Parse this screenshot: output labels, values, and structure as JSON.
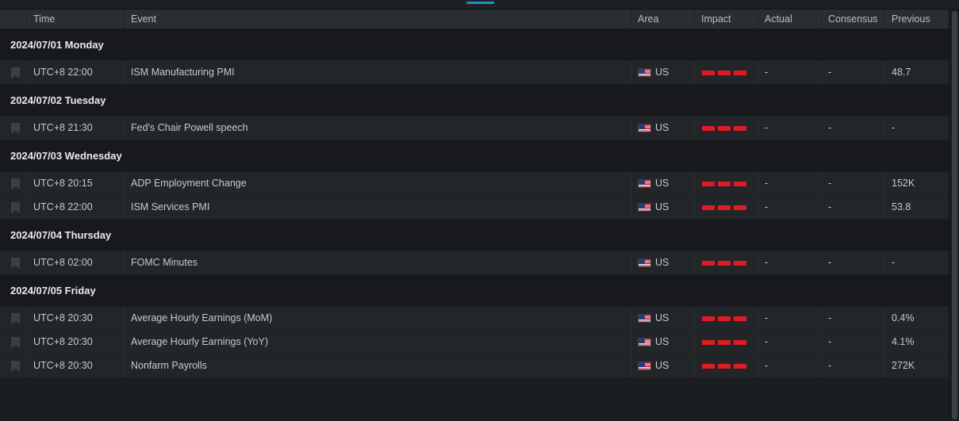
{
  "window": {
    "tab_indicator_color": "#1c94c4",
    "accent_color": "#1c94c4",
    "impact_active_color": "#e01b24",
    "impact_inactive_color": "#3a3d41"
  },
  "table": {
    "columns": [
      {
        "key": "bookmark",
        "label": ""
      },
      {
        "key": "time",
        "label": "Time"
      },
      {
        "key": "event",
        "label": "Event"
      },
      {
        "key": "area",
        "label": "Area"
      },
      {
        "key": "impact",
        "label": "Impact"
      },
      {
        "key": "actual",
        "label": "Actual"
      },
      {
        "key": "consensus",
        "label": "Consensus"
      },
      {
        "key": "previous",
        "label": "Previous"
      }
    ],
    "groups": [
      {
        "date": "2024/07/01 Monday",
        "rows": [
          {
            "bookmark_icon": "bookmark-icon",
            "time": "UTC+8 22:00",
            "event": "ISM Manufacturing PMI",
            "area": "US",
            "flag_icon": "us-flag-icon",
            "impact": 3,
            "impact_max": 3,
            "actual": "-",
            "consensus": "-",
            "previous": "48.7"
          }
        ]
      },
      {
        "date": "2024/07/02 Tuesday",
        "rows": [
          {
            "bookmark_icon": "bookmark-icon",
            "time": "UTC+8 21:30",
            "event": "Fed's Chair Powell speech",
            "area": "US",
            "flag_icon": "us-flag-icon",
            "impact": 3,
            "impact_max": 3,
            "actual": "-",
            "consensus": "-",
            "previous": "-"
          }
        ]
      },
      {
        "date": "2024/07/03 Wednesday",
        "rows": [
          {
            "bookmark_icon": "bookmark-icon",
            "time": "UTC+8 20:15",
            "event": "ADP Employment Change",
            "area": "US",
            "flag_icon": "us-flag-icon",
            "impact": 3,
            "impact_max": 3,
            "actual": "-",
            "consensus": "-",
            "previous": "152K"
          },
          {
            "bookmark_icon": "bookmark-icon",
            "time": "UTC+8 22:00",
            "event": "ISM Services PMI",
            "area": "US",
            "flag_icon": "us-flag-icon",
            "impact": 3,
            "impact_max": 3,
            "actual": "-",
            "consensus": "-",
            "previous": "53.8"
          }
        ]
      },
      {
        "date": "2024/07/04 Thursday",
        "rows": [
          {
            "bookmark_icon": "bookmark-icon",
            "time": "UTC+8 02:00",
            "event": "FOMC Minutes",
            "area": "US",
            "flag_icon": "us-flag-icon",
            "impact": 3,
            "impact_max": 3,
            "actual": "-",
            "consensus": "-",
            "previous": "-"
          }
        ]
      },
      {
        "date": "2024/07/05 Friday",
        "rows": [
          {
            "bookmark_icon": "bookmark-icon",
            "time": "UTC+8 20:30",
            "event": "Average Hourly Earnings (MoM)",
            "area": "US",
            "flag_icon": "us-flag-icon",
            "impact": 3,
            "impact_max": 3,
            "actual": "-",
            "consensus": "-",
            "previous": "0.4%"
          },
          {
            "bookmark_icon": "bookmark-icon",
            "time": "UTC+8 20:30",
            "event": "Average Hourly Earnings (YoY)",
            "area": "US",
            "flag_icon": "us-flag-icon",
            "impact": 3,
            "impact_max": 3,
            "actual": "-",
            "consensus": "-",
            "previous": "4.1%"
          },
          {
            "bookmark_icon": "bookmark-icon",
            "time": "UTC+8 20:30",
            "event": "Nonfarm Payrolls",
            "area": "US",
            "flag_icon": "us-flag-icon",
            "impact": 3,
            "impact_max": 3,
            "actual": "-",
            "consensus": "-",
            "previous": "272K"
          }
        ]
      }
    ]
  },
  "scrollbar": {
    "name": "vertical-scrollbar"
  }
}
